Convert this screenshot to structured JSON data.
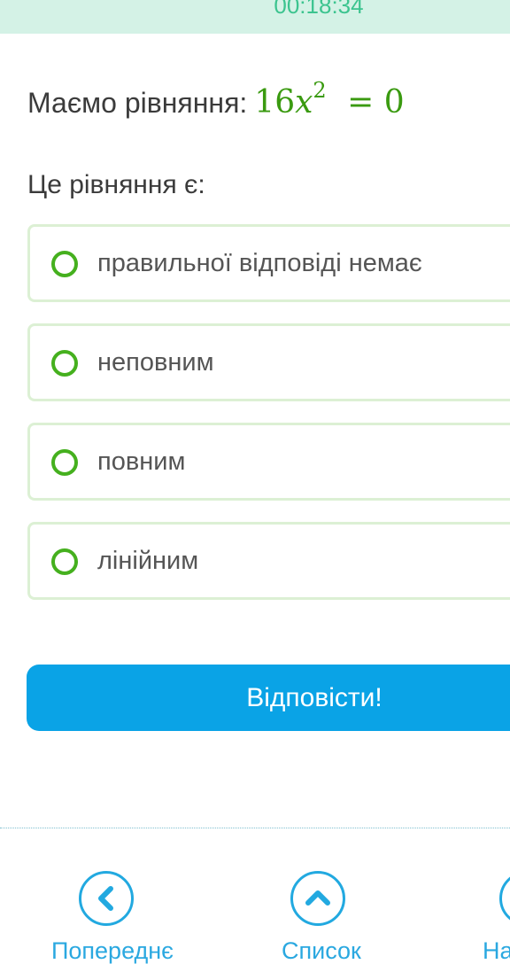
{
  "timer": {
    "value": "00:18:34"
  },
  "question": {
    "intro": "Маємо рівняння:",
    "equation": {
      "coefficient": "16",
      "variable": "x",
      "exponent": "2",
      "rhs": "= 0"
    }
  },
  "prompt": "Це рівняння є:",
  "options": [
    {
      "label": "правильної відповіді немає"
    },
    {
      "label": "неповним"
    },
    {
      "label": "повним"
    },
    {
      "label": "лінійним"
    }
  ],
  "answer_button": {
    "label": "Відповісти!"
  },
  "bottom_nav": {
    "prev_label": "Попереднє",
    "list_label": "Список",
    "next_label": "На"
  },
  "colors": {
    "timer_bg": "#d4f2e6",
    "timer_text": "#3cc48f",
    "equation": "#3a9a10",
    "radio": "#45b01e",
    "option_border": "#dcf0d4",
    "button_bg": "#0aa3e6",
    "nav": "#22a9e0"
  },
  "icons": {
    "prev": "chevron-left-icon",
    "list": "chevron-up-icon",
    "next": "chevron-right-icon"
  }
}
